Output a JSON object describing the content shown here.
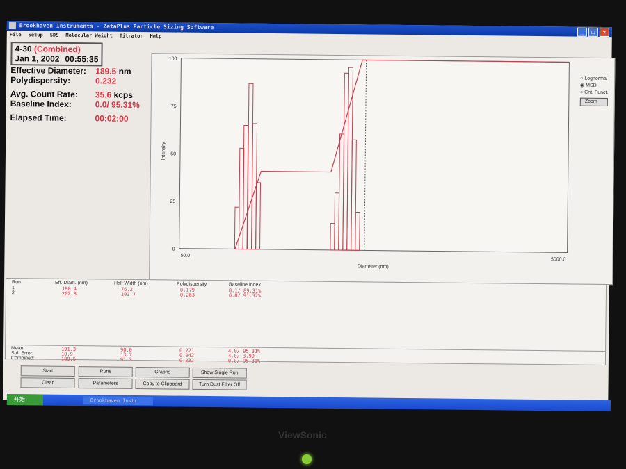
{
  "window": {
    "title": "Brookhaven Instruments - ZetaPlus Particle Sizing Software",
    "controls": [
      "_",
      "□",
      "×"
    ]
  },
  "menu": [
    "File",
    "Setup",
    "SDS",
    "Molecular Weight",
    "Titrator",
    "Help"
  ],
  "info": {
    "sample": "4-30",
    "combined": "(Combined)",
    "date": "Jan 1, 2002",
    "time": "00:55:35",
    "eff_diam_label": "Effective Diameter:",
    "eff_diam": "189.5",
    "eff_diam_unit": "nm",
    "poly_label": "Polydispersity:",
    "poly": "0.232",
    "count_label": "Avg. Count Rate:",
    "count": "35.6",
    "count_unit": "kcps",
    "baseline_label": "Baseline Index:",
    "baseline": "0.0/ 95.31%",
    "elapsed_label": "Elapsed Time:",
    "elapsed": "00:02:00"
  },
  "chart_data": {
    "type": "bar",
    "xlabel": "Diameter (nm)",
    "ylabel": "Intensity",
    "xscale": "log",
    "xlim": [
      50.0,
      5000.0
    ],
    "ylim": [
      0,
      100
    ],
    "x_tick_labels": [
      "50.0",
      "5000.0"
    ],
    "y_ticks": [
      "0",
      "25",
      "50",
      "75",
      "100"
    ],
    "bars": [
      {
        "d": 99,
        "v": 22
      },
      {
        "d": 104,
        "v": 53
      },
      {
        "d": 109,
        "v": 65
      },
      {
        "d": 115,
        "v": 87
      },
      {
        "d": 121,
        "v": 66
      },
      {
        "d": 127,
        "v": 35
      },
      {
        "d": 308,
        "v": 14
      },
      {
        "d": 323,
        "v": 30
      },
      {
        "d": 340,
        "v": 61
      },
      {
        "d": 357,
        "v": 93
      },
      {
        "d": 375,
        "v": 96
      },
      {
        "d": 394,
        "v": 58
      },
      {
        "d": 414,
        "v": 20
      }
    ],
    "cumulative": [
      [
        97,
        0
      ],
      [
        131,
        41
      ],
      [
        300,
        41
      ],
      [
        430,
        100
      ],
      [
        5000,
        100
      ]
    ],
    "marker_line": 450,
    "color": "#c04050"
  },
  "options": {
    "radios": [
      {
        "label": "Lognormal",
        "checked": false
      },
      {
        "label": "MSD",
        "checked": true
      },
      {
        "label": "Cnt. Funct.",
        "checked": false
      }
    ],
    "zoom": "Zoom"
  },
  "table": {
    "headers": [
      "Run",
      "Eff. Diam. (nm)",
      "Half Width (nm)",
      "Polydispersity",
      "Baseline Index"
    ],
    "rows": [
      [
        "1",
        "180.4",
        "76.2",
        "0.179",
        "8.1/ 89.31%"
      ],
      [
        "2",
        "202.3",
        "103.7",
        "0.263",
        "0.8/ 91.32%"
      ]
    ],
    "summary": [
      [
        "Mean:",
        "191.3",
        "90.0",
        "0.221",
        "4.0/ 95.31%"
      ],
      [
        "Std. Error:",
        "10.9",
        "13.7",
        "0.042",
        "4.0/ 3.99"
      ],
      [
        "Combined:",
        "189.5",
        "91.3",
        "0.232",
        "0.0/ 95.31%"
      ]
    ]
  },
  "buttons": [
    "Start",
    "Runs",
    "Graphs",
    "Show Single Run",
    "Clear",
    "Parameters",
    "Copy to Clipboard",
    "Turn Dust Filter Off"
  ],
  "taskbar": {
    "start": "开始",
    "item": "Brookhaven Instr"
  },
  "monitor_brand": "ViewSonic"
}
